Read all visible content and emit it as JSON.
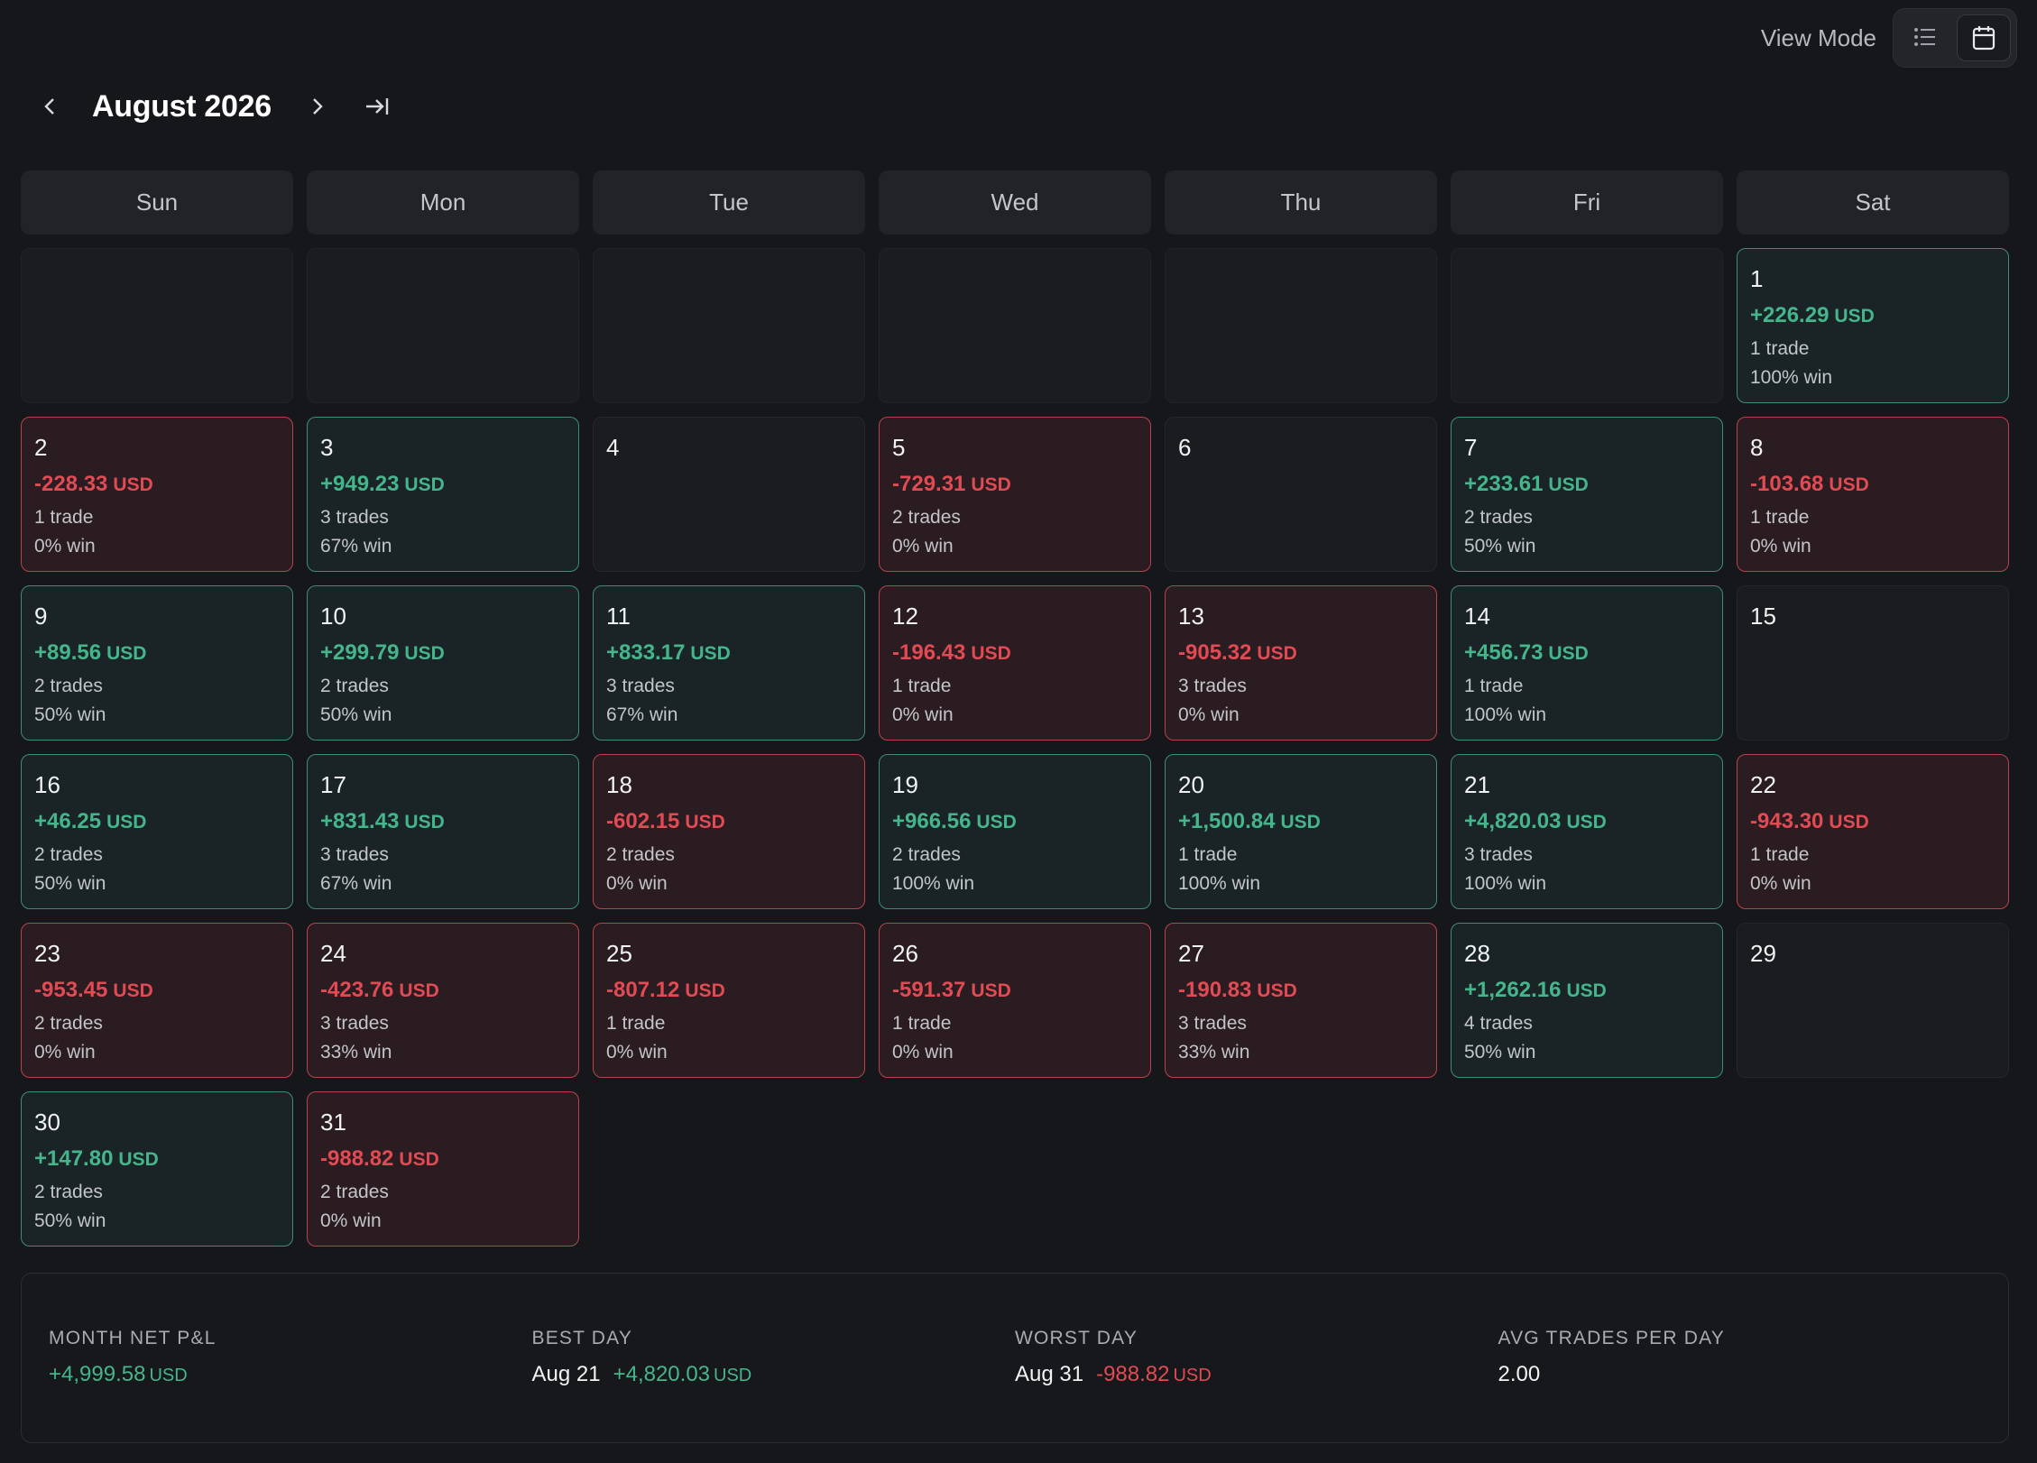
{
  "header": {
    "view_mode_label": "View Mode",
    "view_modes": [
      {
        "name": "list",
        "icon": "list-icon",
        "active": false
      },
      {
        "name": "calendar",
        "icon": "calendar-icon",
        "active": true
      }
    ],
    "month_title": "August 2026"
  },
  "weekdays": [
    "Sun",
    "Mon",
    "Tue",
    "Wed",
    "Thu",
    "Fri",
    "Sat"
  ],
  "currency": "USD",
  "leading_blanks": 6,
  "days": [
    {
      "day": "1",
      "pnl": "+226.29",
      "trades": "1 trade",
      "win": "100% win",
      "status": "pos"
    },
    {
      "day": "2",
      "pnl": "-228.33",
      "trades": "1 trade",
      "win": "0% win",
      "status": "neg"
    },
    {
      "day": "3",
      "pnl": "+949.23",
      "trades": "3 trades",
      "win": "67% win",
      "status": "pos"
    },
    {
      "day": "4",
      "status": "none"
    },
    {
      "day": "5",
      "pnl": "-729.31",
      "trades": "2 trades",
      "win": "0% win",
      "status": "neg"
    },
    {
      "day": "6",
      "status": "none"
    },
    {
      "day": "7",
      "pnl": "+233.61",
      "trades": "2 trades",
      "win": "50% win",
      "status": "pos"
    },
    {
      "day": "8",
      "pnl": "-103.68",
      "trades": "1 trade",
      "win": "0% win",
      "status": "neg"
    },
    {
      "day": "9",
      "pnl": "+89.56",
      "trades": "2 trades",
      "win": "50% win",
      "status": "pos"
    },
    {
      "day": "10",
      "pnl": "+299.79",
      "trades": "2 trades",
      "win": "50% win",
      "status": "pos"
    },
    {
      "day": "11",
      "pnl": "+833.17",
      "trades": "3 trades",
      "win": "67% win",
      "status": "pos"
    },
    {
      "day": "12",
      "pnl": "-196.43",
      "trades": "1 trade",
      "win": "0% win",
      "status": "neg"
    },
    {
      "day": "13",
      "pnl": "-905.32",
      "trades": "3 trades",
      "win": "0% win",
      "status": "neg"
    },
    {
      "day": "14",
      "pnl": "+456.73",
      "trades": "1 trade",
      "win": "100% win",
      "status": "pos"
    },
    {
      "day": "15",
      "status": "none"
    },
    {
      "day": "16",
      "pnl": "+46.25",
      "trades": "2 trades",
      "win": "50% win",
      "status": "pos"
    },
    {
      "day": "17",
      "pnl": "+831.43",
      "trades": "3 trades",
      "win": "67% win",
      "status": "pos"
    },
    {
      "day": "18",
      "pnl": "-602.15",
      "trades": "2 trades",
      "win": "0% win",
      "status": "neg"
    },
    {
      "day": "19",
      "pnl": "+966.56",
      "trades": "2 trades",
      "win": "100% win",
      "status": "pos"
    },
    {
      "day": "20",
      "pnl": "+1,500.84",
      "trades": "1 trade",
      "win": "100% win",
      "status": "pos"
    },
    {
      "day": "21",
      "pnl": "+4,820.03",
      "trades": "3 trades",
      "win": "100% win",
      "status": "pos"
    },
    {
      "day": "22",
      "pnl": "-943.30",
      "trades": "1 trade",
      "win": "0% win",
      "status": "neg"
    },
    {
      "day": "23",
      "pnl": "-953.45",
      "trades": "2 trades",
      "win": "0% win",
      "status": "neg"
    },
    {
      "day": "24",
      "pnl": "-423.76",
      "trades": "3 trades",
      "win": "33% win",
      "status": "neg"
    },
    {
      "day": "25",
      "pnl": "-807.12",
      "trades": "1 trade",
      "win": "0% win",
      "status": "neg"
    },
    {
      "day": "26",
      "pnl": "-591.37",
      "trades": "1 trade",
      "win": "0% win",
      "status": "neg"
    },
    {
      "day": "27",
      "pnl": "-190.83",
      "trades": "3 trades",
      "win": "33% win",
      "status": "neg"
    },
    {
      "day": "28",
      "pnl": "+1,262.16",
      "trades": "4 trades",
      "win": "50% win",
      "status": "pos"
    },
    {
      "day": "29",
      "status": "none"
    },
    {
      "day": "30",
      "pnl": "+147.80",
      "trades": "2 trades",
      "win": "50% win",
      "status": "pos"
    },
    {
      "day": "31",
      "pnl": "-988.82",
      "trades": "2 trades",
      "win": "0% win",
      "status": "neg"
    }
  ],
  "summary": {
    "net": {
      "label": "MONTH NET P&L",
      "value": "+4,999.58",
      "currency": "USD"
    },
    "best": {
      "label": "BEST DAY",
      "date": "Aug 21",
      "value": "+4,820.03",
      "currency": "USD"
    },
    "worst": {
      "label": "WORST DAY",
      "date": "Aug 31",
      "value": "-988.82",
      "currency": "USD"
    },
    "avg": {
      "label": "AVG TRADES PER DAY",
      "value": "2.00"
    }
  },
  "colors": {
    "positive": "#45b58c",
    "negative": "#e24a54",
    "background": "#16171b"
  }
}
